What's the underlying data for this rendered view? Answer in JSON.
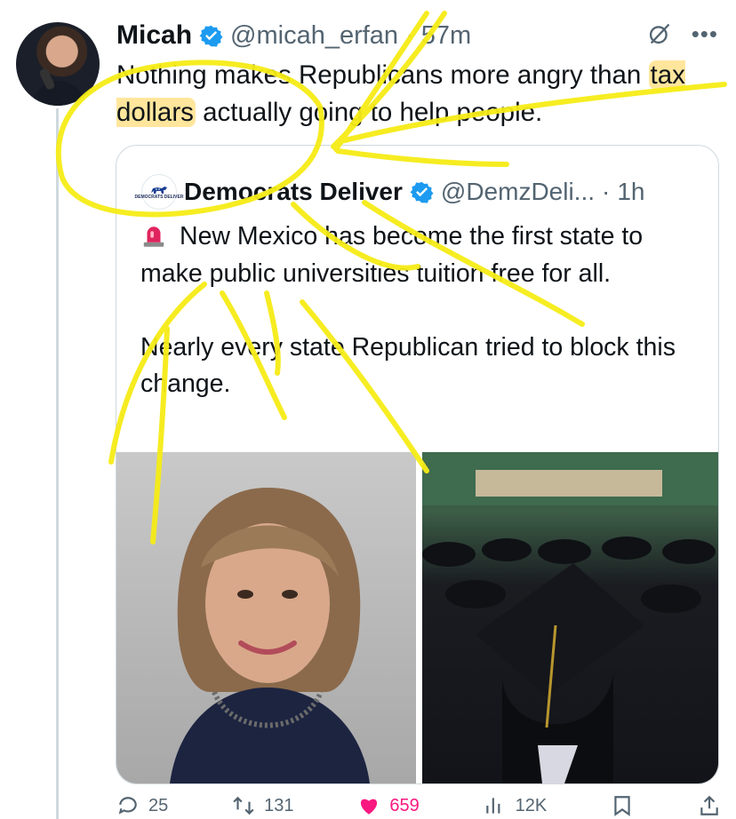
{
  "tweet": {
    "author_name": "Micah",
    "handle": "@micah_erfan",
    "separator": "·",
    "time": "57m",
    "text_part1": "Nothing makes Republicans more angry than ",
    "text_highlight": "tax dollars",
    "text_part2": " actually going to help people."
  },
  "quoted": {
    "author_name": "Democrats Deliver",
    "handle": "@DemzDeli...",
    "separator": "·",
    "time": "1h",
    "logo_text": "DEMOCRATS DELIVER",
    "text_line1": "New Mexico has become the first state to make public universities tuition free for all.",
    "text_line2": "Nearly every state Republican tried to block this change."
  },
  "actions": {
    "reply_count": "25",
    "repost_count": "131",
    "like_count": "659",
    "view_count": "12K"
  },
  "colors": {
    "verified_blue": "#1d9bf0",
    "highlight_yellow": "#ffd65a",
    "annotation_yellow": "#f6ec16",
    "like_pink": "#f91880"
  },
  "icons": {
    "verified": "verified-badge-icon",
    "grok": "grok-icon",
    "more": "more-icon",
    "siren": "siren-icon"
  }
}
